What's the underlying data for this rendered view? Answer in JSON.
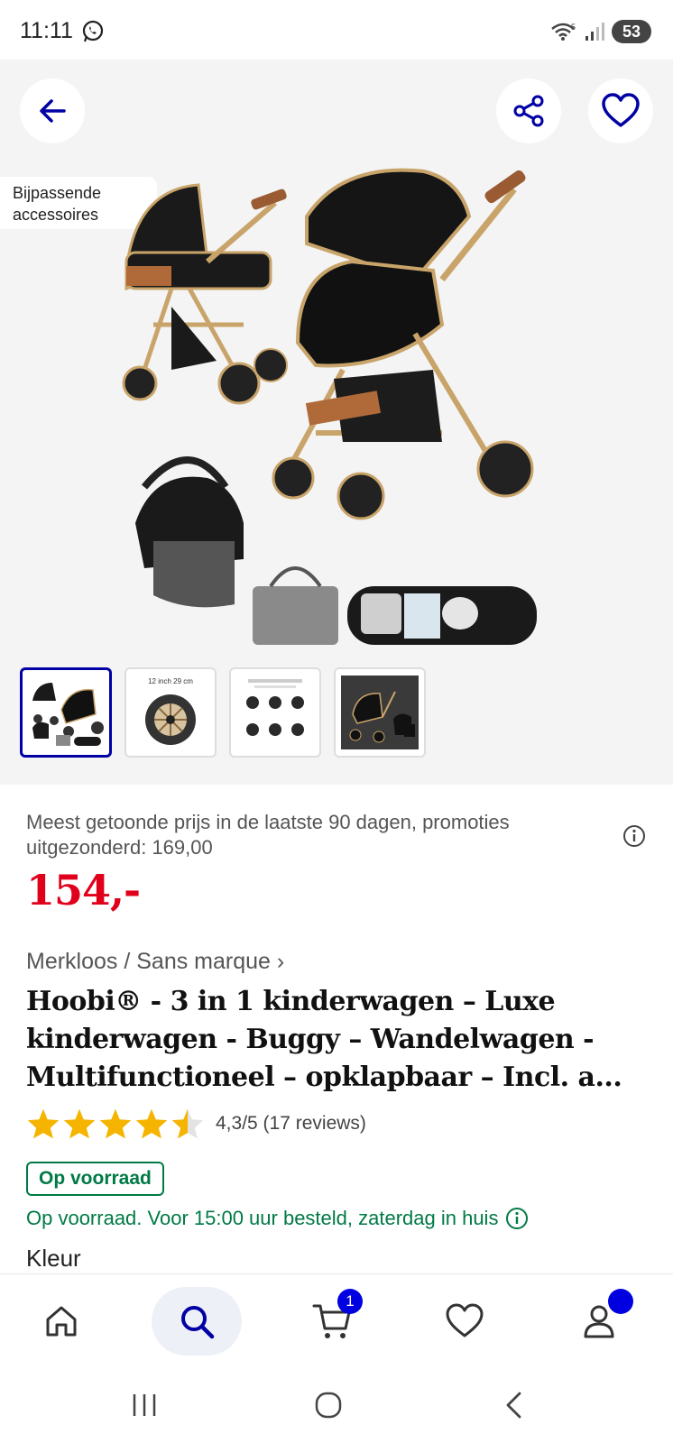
{
  "status_bar": {
    "time": "11:11",
    "battery": "53",
    "icons": [
      "whatsapp-icon",
      "wifi-icon",
      "signal-icon",
      "battery-icon"
    ]
  },
  "gallery": {
    "accessories_tag": "Bijpassende accessoires",
    "thumbnails": [
      {
        "caption": ""
      },
      {
        "caption": "12 inch 29 cm"
      },
      {
        "caption": ""
      },
      {
        "caption": ""
      }
    ],
    "active_thumbnail": 0
  },
  "price": {
    "note": "Meest getoonde prijs in de laatste 90 dagen, promoties uitgezonderd: 169,00",
    "current": "154,-"
  },
  "product": {
    "brand": "Merkloos / Sans marque",
    "title": "Hoobi® - 3 in 1 kinderwagen – Luxe kinderwagen - Buggy – Wandelwagen - Multifunctioneel – opklapbaar – Incl. a...",
    "rating_value": 4.3,
    "rating_text": "4,3/5 (17 reviews)",
    "stock_badge": "Op voorraad",
    "delivery": "Op voorraad. Voor 15:00 uur besteld, zaterdag in huis",
    "color_label": "Kleur"
  },
  "bottom_nav": {
    "items": [
      "home-icon",
      "search-icon",
      "cart-icon",
      "heart-icon",
      "account-icon"
    ],
    "cart_count": "1"
  },
  "colors": {
    "brand_blue": "#0000a4",
    "price_red": "#e0001b",
    "stock_green": "#007a45",
    "star_yellow": "#f5b400"
  }
}
